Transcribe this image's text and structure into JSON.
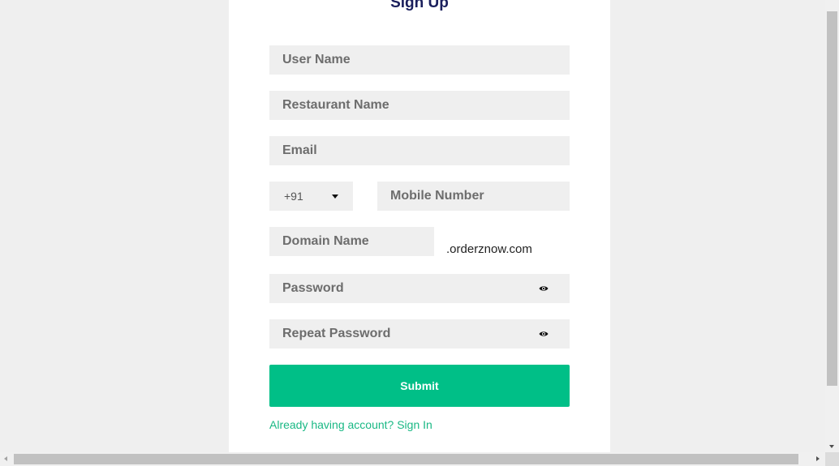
{
  "form": {
    "title": "Sign Up",
    "user_name_placeholder": "User Name",
    "restaurant_name_placeholder": "Restaurant Name",
    "email_placeholder": "Email",
    "country_code": "+91",
    "mobile_placeholder": "Mobile Number",
    "domain_placeholder": "Domain Name",
    "domain_suffix": ".orderznow.com",
    "password_placeholder": "Password",
    "repeat_password_placeholder": "Repeat Password",
    "submit_label": "Submit",
    "signin_link": "Already having account? Sign In"
  },
  "colors": {
    "accent": "#00bf87",
    "title": "#1a1f5c",
    "link": "#19b884",
    "field_bg": "#efefef",
    "page_bg": "#efefef"
  },
  "icons": {
    "password_toggle": "eye-icon",
    "country_dropdown": "caret-down-icon"
  }
}
